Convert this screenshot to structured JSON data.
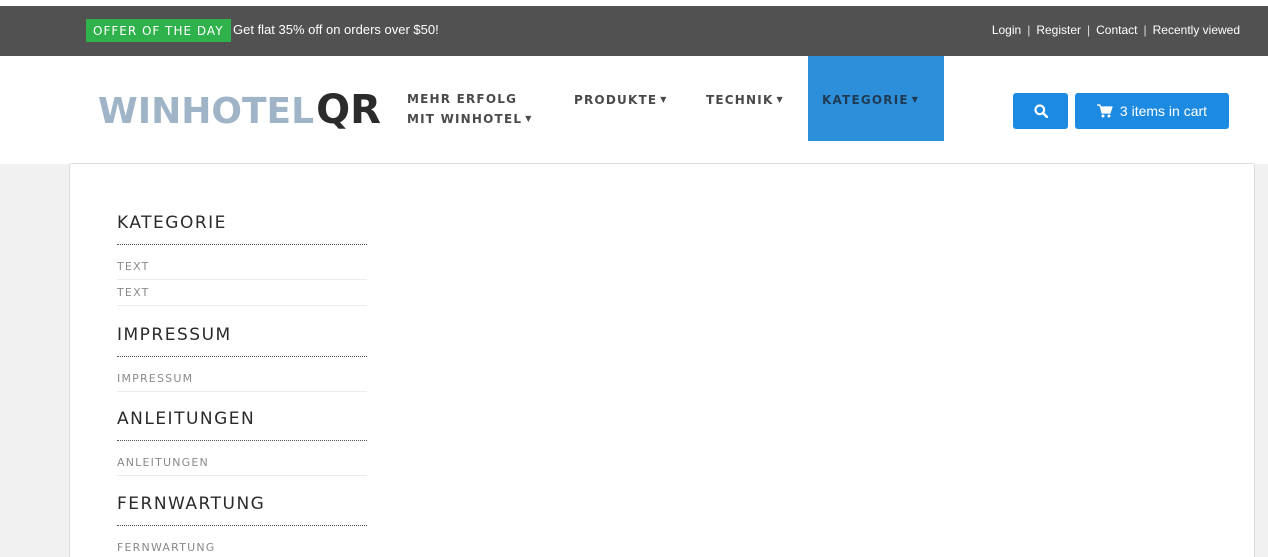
{
  "topbar": {
    "offer_badge": "OFFER OF THE DAY",
    "offer_text": "Get flat 35% off on orders over $50!",
    "links": [
      "Login",
      "Register",
      "Contact",
      "Recently viewed"
    ],
    "separator": "|"
  },
  "header": {
    "logo_win": "WINHOTEL",
    "logo_qr": "QR",
    "nav": [
      {
        "label_line1": "MEHR ERFOLG",
        "label_line2": "MIT WINHOTEL"
      },
      {
        "label_line1": "PRODUKTE"
      },
      {
        "label_line1": "TECHNIK"
      },
      {
        "label_line1": "KATEGORIE"
      }
    ],
    "cart_label": "3 items in cart",
    "colors": {
      "accent": "#1c8ae0",
      "active_nav": "#2d8fd9",
      "offer": "#2fb24c"
    }
  },
  "sidebar": {
    "sections": [
      {
        "title": "KATEGORIE",
        "items": [
          "TEXT",
          "TEXT"
        ]
      },
      {
        "title": "IMPRESSUM",
        "items": [
          "IMPRESSUM"
        ]
      },
      {
        "title": "ANLEITUNGEN",
        "items": [
          "ANLEITUNGEN"
        ]
      },
      {
        "title": "FERNWARTUNG",
        "items": [
          "FERNWARTUNG"
        ]
      }
    ]
  },
  "icons": {
    "search": "search-icon",
    "cart": "cart-icon",
    "caret": "caret-down-icon"
  }
}
